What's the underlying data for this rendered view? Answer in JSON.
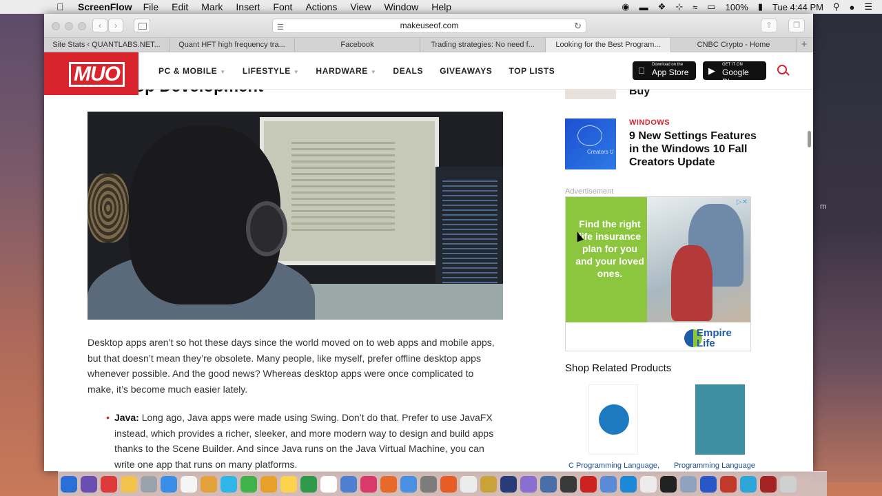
{
  "menubar": {
    "app_name": "ScreenFlow",
    "items": [
      "File",
      "Edit",
      "Mark",
      "Insert",
      "Font",
      "Actions",
      "View",
      "Window",
      "Help"
    ],
    "battery": "100%",
    "clock": "Tue 4:44 PM"
  },
  "browser": {
    "url": "makeuseof.com",
    "tabs": [
      "Site Stats ‹ QUANTLABS.NET...",
      "Quant HFT high frequency tra...",
      "Facebook",
      "Trading strategies: No need f...",
      "Looking for the Best Program...",
      "CNBC Crypto - Home"
    ]
  },
  "site": {
    "logo": "MUO",
    "nav": [
      {
        "label": "PC & MOBILE",
        "caret": true
      },
      {
        "label": "LIFESTYLE",
        "caret": true
      },
      {
        "label": "HARDWARE",
        "caret": true
      },
      {
        "label": "DEALS",
        "caret": false
      },
      {
        "label": "GIVEAWAYS",
        "caret": false
      },
      {
        "label": "TOP LISTS",
        "caret": false
      }
    ],
    "app_store": {
      "small": "Download on the",
      "big": "App Store"
    },
    "google_play": {
      "small": "GET IT ON",
      "big": "Google Play"
    }
  },
  "article": {
    "heading_partial": "ktop Development",
    "paragraph": "Desktop apps aren’t so hot these days since the world moved on to web apps and mobile apps, but that doesn’t mean they’re obsolete. Many people, like myself, prefer offline desktop apps whenever possible. And the good news? Whereas desktop apps were once complicated to make, it’s become much easier lately.",
    "bullet_label": "Java:",
    "bullet_text": " Long ago, Java apps were made using Swing. Don’t do that. Prefer to use JavaFX instead, which provides a richer, sleeker, and more modern way to design and build apps thanks to the Scene Builder. And since Java runs on the Java Virtual Machine, you can write one app that runs on many platforms."
  },
  "sidebar": {
    "prev_title_partial": "Buy",
    "category": "WINDOWS",
    "title": "9 New Settings Features in the Windows 10 Fall Creators Update",
    "thumb_caption": "Creators U",
    "ad_label": "Advertisement",
    "ad_headline": "Find the right life insurance plan for you and your loved ones.",
    "ad_brand_line1": "Empire",
    "ad_brand_line2": "Life",
    "shop_title": "Shop Related Products",
    "products": [
      "C Programming Language,",
      "Programming Language"
    ]
  },
  "desktop": {
    "partial_text": "m"
  },
  "dock_colors": [
    "#2a6fd6",
    "#6b4fb0",
    "#dd3a3a",
    "#f3c24a",
    "#9aa3ab",
    "#3b8ee8",
    "#f5f5f5",
    "#e4a23a",
    "#2fb5e8",
    "#3fb24b",
    "#e7a12a",
    "#fcd34d",
    "#2f9b4a",
    "#ffffff",
    "#4f7fd1",
    "#d93a6a",
    "#e76a2b",
    "#4a90e2",
    "#7c7c7c",
    "#e85d25",
    "#ececec",
    "#c9a23a",
    "#2a3b7a",
    "#8a6fd0",
    "#4a6ea8",
    "#3a3a3a",
    "#c22",
    "#5a8bd8",
    "#1c88d8",
    "#ececec",
    "#222",
    "#8fa3bf",
    "#2a57c7",
    "#c0392b",
    "#2ea6d9",
    "#a42424",
    "#d0d0d0"
  ]
}
